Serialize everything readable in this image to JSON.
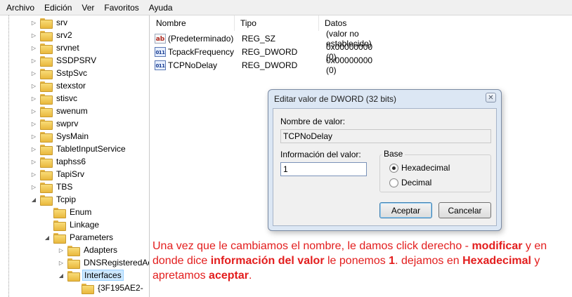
{
  "menubar": {
    "items": [
      "Archivo",
      "Edición",
      "Ver",
      "Favoritos",
      "Ayuda"
    ]
  },
  "tree": {
    "items": [
      {
        "label": "srv",
        "level": 1,
        "expander": "▷"
      },
      {
        "label": "srv2",
        "level": 1,
        "expander": "▷"
      },
      {
        "label": "srvnet",
        "level": 1,
        "expander": "▷"
      },
      {
        "label": "SSDPSRV",
        "level": 1,
        "expander": "▷"
      },
      {
        "label": "SstpSvc",
        "level": 1,
        "expander": "▷"
      },
      {
        "label": "stexstor",
        "level": 1,
        "expander": "▷"
      },
      {
        "label": "stisvc",
        "level": 1,
        "expander": "▷"
      },
      {
        "label": "swenum",
        "level": 1,
        "expander": "▷"
      },
      {
        "label": "swprv",
        "level": 1,
        "expander": "▷"
      },
      {
        "label": "SysMain",
        "level": 1,
        "expander": "▷"
      },
      {
        "label": "TabletInputService",
        "level": 1,
        "expander": "▷"
      },
      {
        "label": "taphss6",
        "level": 1,
        "expander": "▷"
      },
      {
        "label": "TapiSrv",
        "level": 1,
        "expander": "▷"
      },
      {
        "label": "TBS",
        "level": 1,
        "expander": "▷"
      },
      {
        "label": "Tcpip",
        "level": 1,
        "expander": "◢"
      },
      {
        "label": "Enum",
        "level": 2,
        "expander": ""
      },
      {
        "label": "Linkage",
        "level": 2,
        "expander": ""
      },
      {
        "label": "Parameters",
        "level": 2,
        "expander": "◢"
      },
      {
        "label": "Adapters",
        "level": 3,
        "expander": "▷"
      },
      {
        "label": "DNSRegisteredAdapters",
        "level": 3,
        "expander": "▷"
      },
      {
        "label": "Interfaces",
        "level": 3,
        "expander": "◢",
        "selected": true
      },
      {
        "label": "{3F195AE2-",
        "level": 4,
        "expander": ""
      }
    ]
  },
  "list": {
    "columns": [
      "Nombre",
      "Tipo",
      "Datos"
    ],
    "rows": [
      {
        "icon": "string-value-icon",
        "icon_text": "ab",
        "name": "(Predeterminado)",
        "type": "REG_SZ",
        "data": "(valor no establecido)"
      },
      {
        "icon": "dword-value-icon",
        "icon_text": "011",
        "name": "TcpackFrequency",
        "type": "REG_DWORD",
        "data": "0x00000000 (0)"
      },
      {
        "icon": "dword-value-icon",
        "icon_text": "011",
        "name": "TCPNoDelay",
        "type": "REG_DWORD",
        "data": "0x00000000 (0)"
      }
    ]
  },
  "dialog": {
    "title": "Editar valor de DWORD (32 bits)",
    "close_glyph": "✕",
    "name_label": "Nombre de valor:",
    "name_value": "TCPNoDelay",
    "data_label": "Información del valor:",
    "data_value": "1",
    "base_label": "Base",
    "radio_hex": "Hexadecimal",
    "radio_dec": "Decimal",
    "base_selected": "Hexadecimal",
    "ok_label": "Aceptar",
    "cancel_label": "Cancelar"
  },
  "note": {
    "p1": "Una vez que le cambiamos el nombre, le damos click derecho - ",
    "b1": "modificar",
    "p2": " y en donde dice ",
    "b2": "información del valor",
    "p3": " le ponemos ",
    "b3": "1",
    "p4": ". dejamos en ",
    "b4": "Hexadecimal",
    "p5": " y apretamos ",
    "b5": "aceptar",
    "p6": "."
  },
  "colors": {
    "note_text": "#e31d1d",
    "dialog_frame": "#dce7f4",
    "selection": "#cce8ff"
  }
}
